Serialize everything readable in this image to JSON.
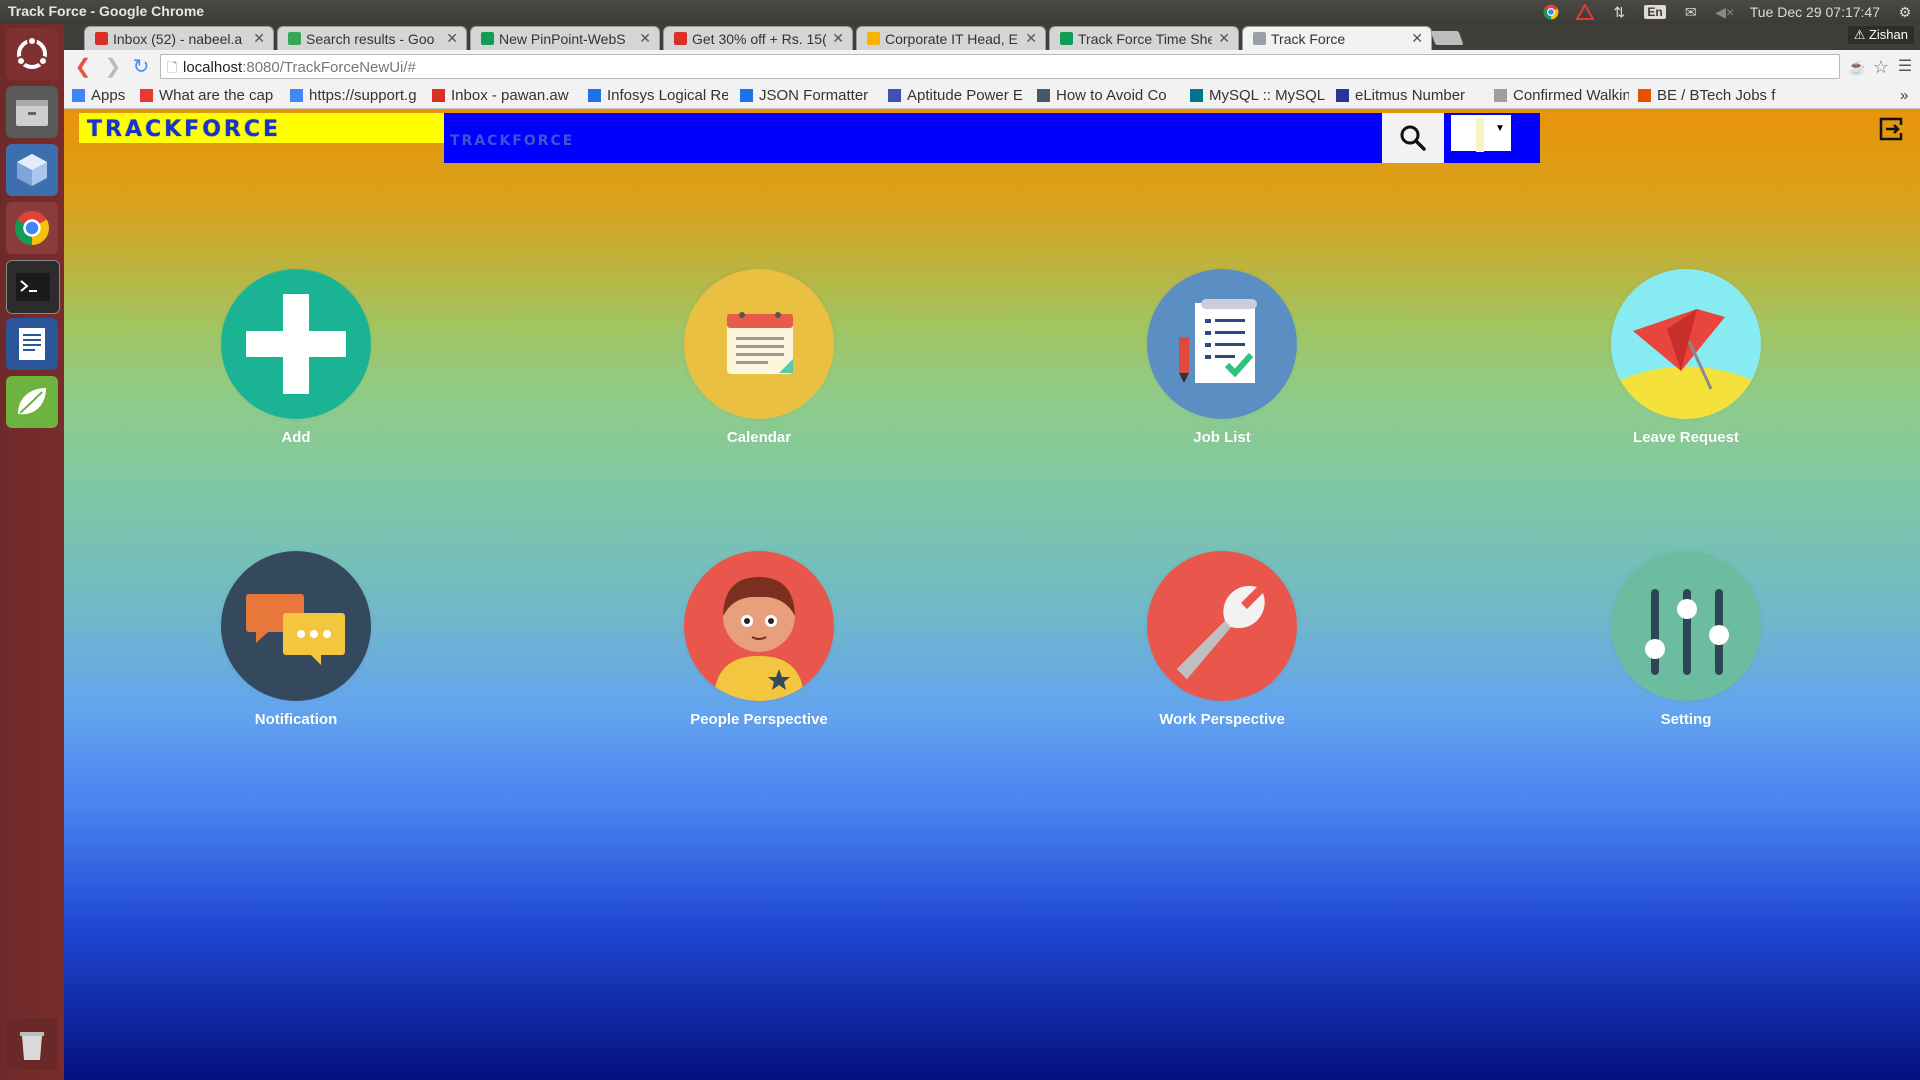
{
  "window": {
    "title": "Track Force - Google Chrome"
  },
  "system_tray": {
    "language": "En",
    "datetime": "Tue Dec 29 07:17:47",
    "user": "Zishan"
  },
  "tabs": [
    {
      "title": "Inbox (52) - nabeel.a",
      "favicon_color": "#d93025"
    },
    {
      "title": "Search results - Goo",
      "favicon_color": "#34a853"
    },
    {
      "title": "New PinPoint-WebS",
      "favicon_color": "#0f9d58"
    },
    {
      "title": "Get 30% off + Rs. 15(",
      "favicon_color": "#d93025"
    },
    {
      "title": "Corporate IT Head, E",
      "favicon_color": "#f4b400"
    },
    {
      "title": "Track Force Time She",
      "favicon_color": "#0f9d58"
    },
    {
      "title": "Track Force",
      "favicon_color": "#9aa0a6",
      "active": true
    }
  ],
  "address_bar": {
    "host": "localhost",
    "path": ":8080/TrackForceNewUi/#"
  },
  "bookmarks": [
    {
      "label": "Apps"
    },
    {
      "label": "What are the cap"
    },
    {
      "label": "https://support.g"
    },
    {
      "label": "Inbox - pawan.aw"
    },
    {
      "label": "Infosys Logical Re"
    },
    {
      "label": "JSON Formatter"
    },
    {
      "label": "Aptitude Power E"
    },
    {
      "label": "How to Avoid Co"
    },
    {
      "label": "MySQL :: MySQL"
    },
    {
      "label": "eLitmus Number"
    },
    {
      "label": "Confirmed Walkin"
    },
    {
      "label": "BE / BTech Jobs f"
    }
  ],
  "app": {
    "logo_text": "TRACKFORCE",
    "header_text": "TRACKFORCE",
    "tiles": [
      {
        "label": "Add",
        "color": "#1ab394",
        "icon": "plus-icon"
      },
      {
        "label": "Calendar",
        "color": "#e9c041",
        "icon": "calendar-icon"
      },
      {
        "label": "Job List",
        "color": "#5b8fc4",
        "icon": "job-list-icon"
      },
      {
        "label": "Leave Request",
        "color": "#87ecf2",
        "icon": "umbrella-icon"
      },
      {
        "label": "Notification",
        "color": "#34495e",
        "icon": "chat-bubbles-icon"
      },
      {
        "label": "People Perspective",
        "color": "#e9564c",
        "icon": "person-icon"
      },
      {
        "label": "Work Perspective",
        "color": "#e9564c",
        "icon": "wrench-icon"
      },
      {
        "label": "Setting",
        "color": "#6cbd9f",
        "icon": "sliders-icon"
      }
    ]
  }
}
